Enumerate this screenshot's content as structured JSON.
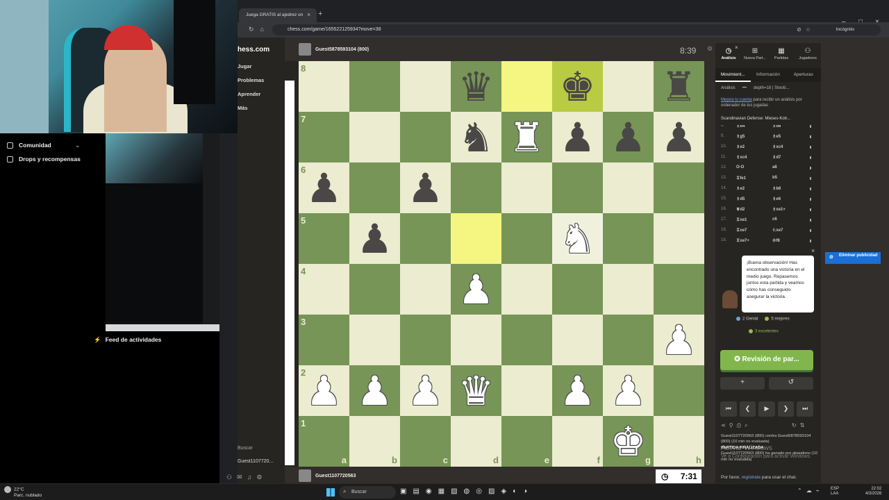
{
  "stream": {
    "community_label": "Comunidad",
    "drops_label": "Drops y recompensas",
    "feed_label": "Feed de actividades"
  },
  "browser": {
    "tab_title": "Juega GRATIS al ajedrez on",
    "url": "chess.com/game/165522125934?move=38",
    "incognito_label": "Incógnito"
  },
  "site": {
    "logo": "hess.com",
    "nav": [
      "Jugar",
      "Problemas",
      "Aprender",
      "Más"
    ],
    "search_label": "Buscar",
    "user_label": "Guest1107720..."
  },
  "top_player": {
    "name": "Guest5878593104 (800)",
    "clock": "8:39"
  },
  "bottom_player": {
    "name": "Guest1107720563",
    "clock": "7:31"
  },
  "board": {
    "ranks": [
      "8",
      "7",
      "6",
      "5",
      "4",
      "3",
      "2",
      "1"
    ],
    "files": [
      "a",
      "b",
      "c",
      "d",
      "e",
      "f",
      "g",
      "h"
    ],
    "highlight": [
      "e8",
      "f8",
      "d5"
    ],
    "hover": "f5",
    "pieces": {
      "d8": "bq",
      "f8": "bk",
      "h8": "br",
      "d7": "bn",
      "e7": "wr",
      "f7": "bp",
      "g7": "bp",
      "h7": "bp",
      "a6": "bp",
      "c6": "bp",
      "b5": "bp",
      "f5": "wn",
      "d4": "wp",
      "h3": "wp",
      "a2": "wp",
      "b2": "wp",
      "c2": "wp",
      "d2": "wq",
      "f2": "wp",
      "g2": "wp",
      "g1": "wk"
    }
  },
  "panel": {
    "tabs": [
      "Análisis",
      "Nueva Part...",
      "Partidas",
      "Jugadores"
    ],
    "subtabs": [
      "Movimient...",
      "Información",
      "Aperturas"
    ],
    "analysis_label": "Análisis",
    "depth_label": "depth=18 | Stockl...",
    "improve_link": "Mejora tu cuenta",
    "improve_text": " para recibir un análisis por ordenador de tus jugadas",
    "opening": "Scandinavian Defense: Mieses-Kotr...",
    "moves": [
      {
        "n": "8.",
        "w": "♗b4",
        "b": "♗d6"
      },
      {
        "n": "9.",
        "w": "♗g5",
        "b": "♗e5"
      },
      {
        "n": "10.",
        "w": "♗e2",
        "b": "♗xc4"
      },
      {
        "n": "11.",
        "w": "♗xc4",
        "b": "♗d7"
      },
      {
        "n": "12.",
        "w": "O-O",
        "b": "a6"
      },
      {
        "n": "13.",
        "w": "♖fe1",
        "b": "b5"
      },
      {
        "n": "14.",
        "w": "♗e2",
        "b": "♗b6"
      },
      {
        "n": "15.",
        "w": "♗d5",
        "b": "♗e6"
      },
      {
        "n": "16.",
        "w": "♕d2",
        "b": "♗xe1+"
      },
      {
        "n": "17.",
        "w": "♖xe1",
        "b": "c6"
      },
      {
        "n": "18.",
        "w": "♖xe7",
        "b": "♘xe7"
      },
      {
        "n": "19.",
        "w": "♖xe7+",
        "b": "♔f8"
      }
    ],
    "coach_text": "¡Buena observación! Has encontrado una victoria en el medio juego. Repasemos juntos esta partida y veamos cómo has conseguido asegurar la victoria.",
    "stats": {
      "genial": "2 Genial",
      "mejores": "5 mejores",
      "excelentes": "3 excelentes"
    },
    "review_button": "Revisión de par...",
    "game_info": {
      "line1": "Guest1107720563 (800) contra Guest5878593104 (800) (10 min no evaluada)",
      "heading": "PARTIDA FINALIZADA",
      "line2": "Guest1107720563 (800) ha ganado por abandono (10 min no evaluada)"
    },
    "chat_prefix": "Por favor, ",
    "chat_link": "regístrate",
    "chat_suffix": " para usar el chat."
  },
  "ad_button": "Eliminar publicidad",
  "watermark": {
    "title": "Activar Windows",
    "sub": "Ve a Configuración para activar Windows."
  },
  "taskbar": {
    "temp": "22°C",
    "weather": "Parc. nublado",
    "search": "Buscar",
    "lang1": "ESP",
    "lang2": "LAA",
    "time": "22:02",
    "date": "4/3/2026"
  },
  "colors": {
    "light_square": "#ebecd0",
    "dark_square": "#779556",
    "review_green": "#81b64c",
    "ad_blue": "#1a6fd6"
  }
}
